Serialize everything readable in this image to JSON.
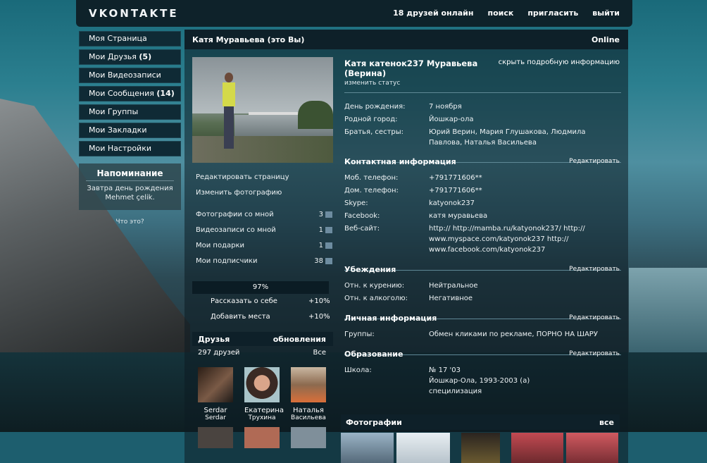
{
  "app": {
    "logo": "VKONTAKTE"
  },
  "topnav": [
    "18 друзей онлайн",
    "поиск",
    "пригласить",
    "выйти"
  ],
  "sidebar": {
    "items": [
      {
        "label": "Моя Страница",
        "count": ""
      },
      {
        "label": "Мои Друзья",
        "count": "(5)"
      },
      {
        "label": "Мои Видеозаписи",
        "count": ""
      },
      {
        "label": "Мои Сообщения",
        "count": "(14)"
      },
      {
        "label": "Мои Группы",
        "count": ""
      },
      {
        "label": "Мои Закладки",
        "count": ""
      },
      {
        "label": "Мои Настройки",
        "count": ""
      }
    ],
    "reminder_title": "Напоминание",
    "reminder_line1": "Завтра день рождения",
    "reminder_line2": "Mehmet çelik.",
    "whats_this": "Что это?"
  },
  "header": {
    "name": "Катя Муравьева (это Вы)",
    "online": "Online"
  },
  "left": {
    "actions": [
      "Редактировать страницу",
      "Изменить фотографию"
    ],
    "counters": [
      {
        "label": "Фотографии со мной",
        "value": "3"
      },
      {
        "label": "Видеозаписи со мной",
        "value": "1"
      },
      {
        "label": "Мои подарки",
        "value": "1"
      },
      {
        "label": "Мои подписчики",
        "value": "38"
      }
    ],
    "progress_text": "97%",
    "progress_value": 97,
    "progress_items": [
      {
        "label": "Рассказать о себе",
        "value": "+10%"
      },
      {
        "label": "Добавить места",
        "value": "+10%"
      }
    ],
    "friends_title": "Друзья",
    "friends_updates": "обновления",
    "friends_count": "297 друзей",
    "friends_all": "Все",
    "friends": [
      {
        "name": "Serdar",
        "surname": "Serdar"
      },
      {
        "name": "Екатерина",
        "surname": "Трухина"
      },
      {
        "name": "Наталья",
        "surname": "Васильева"
      }
    ]
  },
  "profile": {
    "full_name_line1": "Катя катенок237 Муравьева",
    "full_name_line2": "(Верина)",
    "hide_info": "скрыть подробную информацию",
    "change_status": "изменить статус",
    "basic": [
      {
        "k": "День рождения:",
        "v": "7 ноября"
      },
      {
        "k": "Родной город:",
        "v": "Йошкар-ола"
      },
      {
        "k": "Братья, сестры:",
        "v": "Юрий Верин, Мария Глушакова, Людмила Павлова, Наталья Васильева"
      }
    ],
    "edit_label": "Редактировать",
    "contact_title": "Контактная информация",
    "contact": [
      {
        "k": "Моб. телефон:",
        "v": "+791771606**"
      },
      {
        "k": "Дом. телефон:",
        "v": "+791771606**"
      },
      {
        "k": "Skype:",
        "v": "katyonok237"
      },
      {
        "k": "Facebook:",
        "v": "катя муравьева"
      },
      {
        "k": "Веб-сайт:",
        "v": "http:// http://mamba.ru/katyonok237/ http:// www.myspace.com/katyonok237 http:// www.facebook.com/katyonok237"
      }
    ],
    "beliefs_title": "Убеждения",
    "beliefs": [
      {
        "k": "Отн. к курению:",
        "v": "Нейтральное"
      },
      {
        "k": "Отн. к алкоголю:",
        "v": "Негативное"
      }
    ],
    "personal_title": "Личная информация",
    "personal": [
      {
        "k": "Группы:",
        "v": "Обмен кликами по рекламе, ПОРНО НА ШАРУ"
      }
    ],
    "education_title": "Образование",
    "education": [
      {
        "k": "Школа:",
        "v": "№ 17 '03"
      },
      {
        "k": "",
        "v": "Йошкар-Ола, 1993-2003 (а)"
      },
      {
        "k": "",
        "v": "специлизация"
      }
    ],
    "photos_title": "Фотографии",
    "photos_all": "все"
  },
  "colors": {
    "panel": "#0e2029",
    "accent_line": "#5f8896",
    "text": "#ffffff"
  }
}
